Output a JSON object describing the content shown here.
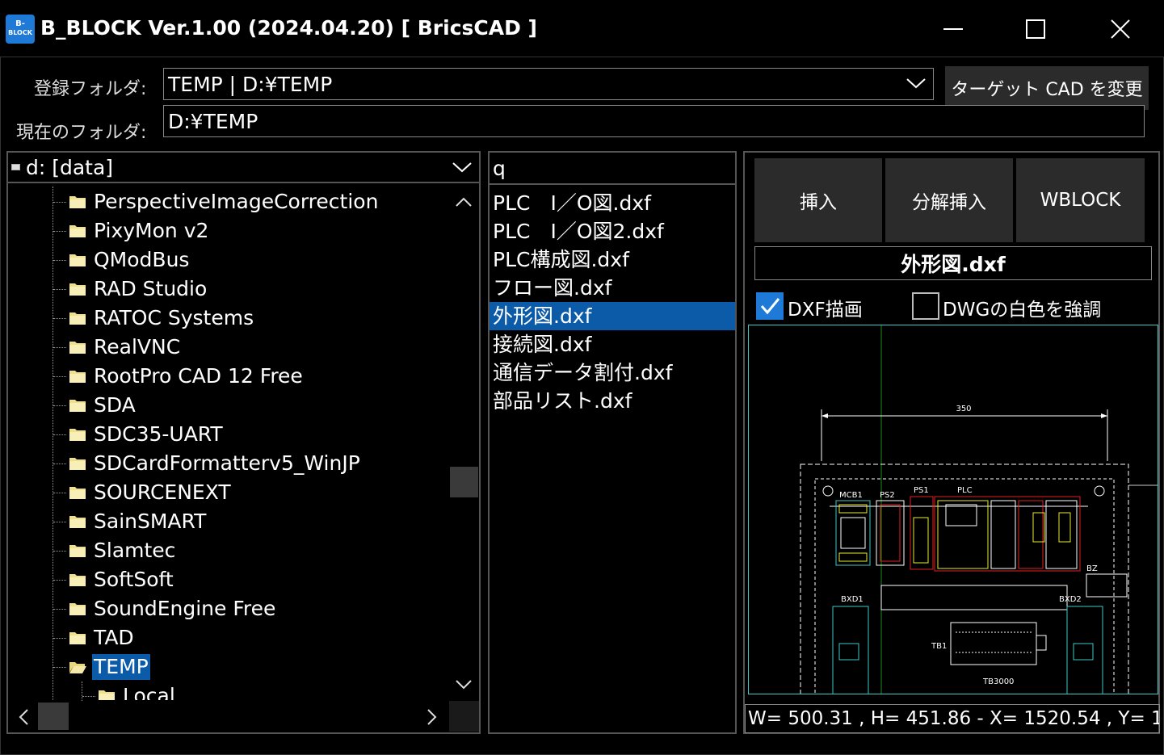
{
  "window": {
    "title": "B_BLOCK Ver.1.00 (2024.04.20) [ BricsCAD ]",
    "icon_text_top": "B-",
    "icon_text_bottom": "BLOCK"
  },
  "top": {
    "registered_folder_label": "登録フォルダ:",
    "registered_folder_value": "TEMP | D:¥TEMP",
    "current_folder_label": "現在のフォルダ:",
    "current_folder_value": "D:¥TEMP",
    "target_cad_button": "ターゲット CAD を変更"
  },
  "tree": {
    "drive": "d: [data]",
    "items": [
      {
        "label": "PerspectiveImageCorrection"
      },
      {
        "label": "PixyMon v2"
      },
      {
        "label": "QModBus"
      },
      {
        "label": "RAD Studio"
      },
      {
        "label": "RATOC Systems"
      },
      {
        "label": "RealVNC"
      },
      {
        "label": "RootPro CAD 12 Free"
      },
      {
        "label": "SDA"
      },
      {
        "label": "SDC35-UART"
      },
      {
        "label": "SDCardFormatterv5_WinJP"
      },
      {
        "label": "SOURCENEXT"
      },
      {
        "label": "SainSMART"
      },
      {
        "label": "Slamtec"
      },
      {
        "label": "SoftSoft"
      },
      {
        "label": "SoundEngine Free"
      },
      {
        "label": "TAD"
      },
      {
        "label": "TEMP"
      },
      {
        "label": "Local"
      }
    ],
    "selected_index": 16
  },
  "files": {
    "filter": "q",
    "items": [
      "PLC　I／O図.dxf",
      "PLC　I／O図2.dxf",
      "PLC構成図.dxf",
      "フロー図.dxf",
      "外形図.dxf",
      "接続図.dxf",
      "通信データ割付.dxf",
      "部品リスト.dxf"
    ],
    "selected_index": 4
  },
  "actions": {
    "insert": "挿入",
    "explode_insert": "分解挿入",
    "wblock": "WBLOCK"
  },
  "preview": {
    "selected_file": "外形図.dxf",
    "dxf_draw_label": "DXF描画",
    "dxf_draw_checked": true,
    "dwg_white_label": "DWGの白色を強調",
    "dwg_white_checked": false,
    "drawing_labels": {
      "dim": "350",
      "mcb1": "MCB1",
      "ps2": "PS2",
      "ps1": "PS1",
      "plc": "PLC",
      "bz": "BZ",
      "bxd1": "BXD1",
      "bxd2": "BXD2",
      "tb1": "TB1",
      "tb3000": "TB3000"
    },
    "colors": {
      "cyan": "#3bc9c9",
      "white": "#ffffff",
      "yellow": "#e8e830",
      "red": "#e02020",
      "green": "#30c030"
    }
  },
  "status": "W= 500.31 , H= 451.86 - X= 1520.54 , Y= 1"
}
